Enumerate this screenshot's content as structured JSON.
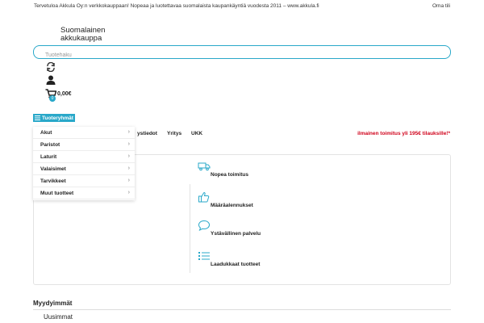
{
  "topbar": {
    "welcome": "Tervetuloa Akkula Oy:n verkkokauppaan! Nopeaa ja luotettavaa suomalaista kaupankäyntiä vuodesta 2011 – www.akkula.fi",
    "account": "Oma tili"
  },
  "logo": {
    "line1": "Suomalainen",
    "line2": "akkukauppa"
  },
  "search": {
    "placeholder": "Tuotehaku",
    "value": ""
  },
  "cart": {
    "total": "0,00€",
    "count": "0"
  },
  "category_button": {
    "label": "Tuoteryhmät",
    "icon": "menu-icon"
  },
  "nav": [
    {
      "label": "ystiedot"
    },
    {
      "label": "Yritys"
    },
    {
      "label": "UKK"
    }
  ],
  "promo": "ilmainen toimitus yli 195€ tilauksille!*",
  "dropdown": [
    {
      "label": "Akut"
    },
    {
      "label": "Paristot"
    },
    {
      "label": "Laturit"
    },
    {
      "label": "Valaisimet"
    },
    {
      "label": "Tarvikkeet"
    },
    {
      "label": "Muut tuotteet"
    }
  ],
  "features": [
    {
      "label": "Nopea toimitus",
      "icon": "truck-icon"
    },
    {
      "label": "Määräalennukset",
      "icon": "thumbs-up-icon"
    },
    {
      "label": "Ystävällinen palvelu",
      "icon": "chat-icon"
    },
    {
      "label": "Laadukkaat tuotteet",
      "icon": "list-icon"
    }
  ],
  "sections": {
    "bestsellers": "Myydyimmät",
    "newest": "Uusimmat"
  },
  "colors": {
    "accent": "#29a8c9",
    "promo": "#d0021b"
  }
}
